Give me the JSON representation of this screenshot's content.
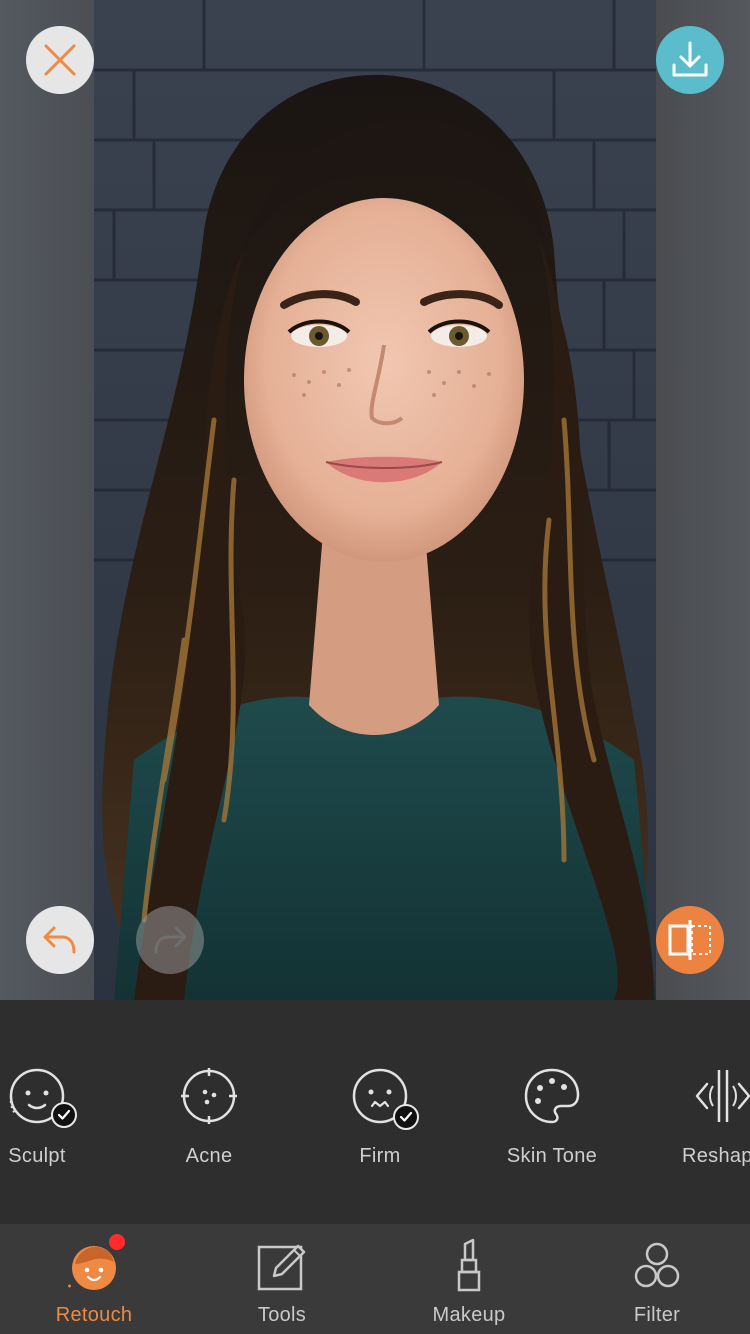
{
  "colors": {
    "accent": "#ee8a43",
    "save_button": "#5bbccc",
    "notification": "#ff2b2b"
  },
  "toolbar": {
    "close_icon": "close-icon",
    "save_icon": "download-icon",
    "undo_icon": "undo-icon",
    "redo_icon": "redo-icon",
    "compare_icon": "compare-icon"
  },
  "tools": [
    {
      "label": "Sculpt",
      "icon": "face-sculpt-icon",
      "applied": true
    },
    {
      "label": "Acne",
      "icon": "acne-icon",
      "applied": false
    },
    {
      "label": "Firm",
      "icon": "face-firm-icon",
      "applied": true
    },
    {
      "label": "Skin Tone",
      "icon": "palette-icon",
      "applied": false
    },
    {
      "label": "Reshap",
      "icon": "reshape-icon",
      "applied": false
    }
  ],
  "nav": {
    "items": [
      {
        "label": "Retouch",
        "icon": "retouch-icon",
        "active": true,
        "notification": true
      },
      {
        "label": "Tools",
        "icon": "edit-icon",
        "active": false
      },
      {
        "label": "Makeup",
        "icon": "lipstick-icon",
        "active": false
      },
      {
        "label": "Filter",
        "icon": "filter-icon",
        "active": false
      }
    ]
  }
}
